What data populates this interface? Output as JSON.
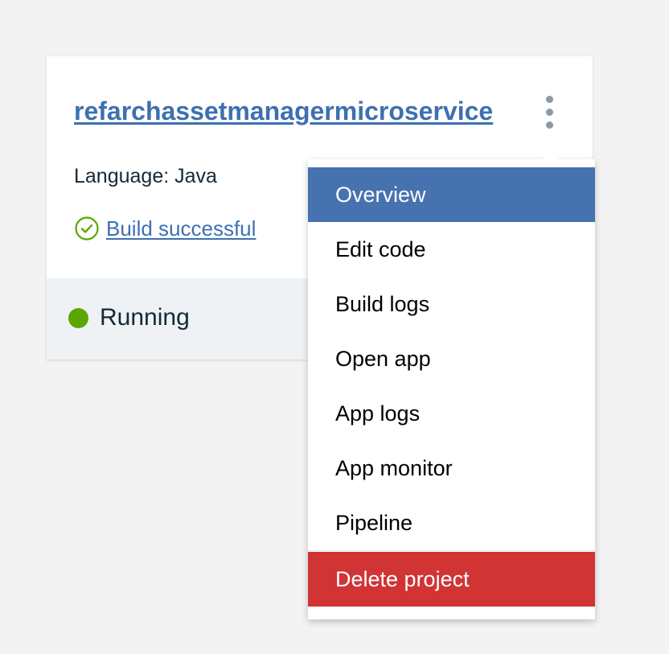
{
  "project": {
    "name": "refarchassetmanagermicroservice",
    "language": "Language: Java",
    "build_status": "Build successful",
    "run_status": "Running"
  },
  "menu": {
    "items": [
      {
        "label": "Overview",
        "state": "highlighted"
      },
      {
        "label": "Edit code"
      },
      {
        "label": "Build logs"
      },
      {
        "label": "Open app"
      },
      {
        "label": "App logs"
      },
      {
        "label": "App monitor"
      },
      {
        "label": "Pipeline"
      }
    ],
    "delete_label": "Delete project"
  },
  "icons": {
    "kebab": "overflow-menu-icon",
    "build": "checkmark-circle-icon",
    "status": "status-dot-icon"
  },
  "colors": {
    "link": "#3d70b2",
    "menu_highlight": "#4672b0",
    "danger": "#d03435",
    "success": "#5aa700",
    "footer_bg": "#eff2f5",
    "page_bg": "#f3f3f3"
  }
}
